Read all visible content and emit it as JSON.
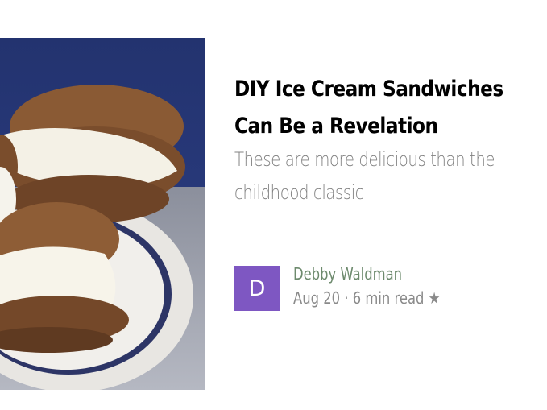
{
  "article": {
    "title": "DIY Ice Cream Sandwiches Can Be a Revelation",
    "subtitle": "These are more delicious than the childhood classic",
    "image_subject": "ice-cream-sandwich-photo"
  },
  "author": {
    "avatar_initial": "D",
    "name": "Debby Waldman",
    "date": "Aug 20",
    "separator": "·",
    "read_time": "6 min read",
    "star": "★"
  },
  "colors": {
    "avatar_bg": "#7e57c2",
    "author_name": "#6d8a6d",
    "meta_text": "#8a8a8a",
    "subtitle_text": "#808080"
  }
}
